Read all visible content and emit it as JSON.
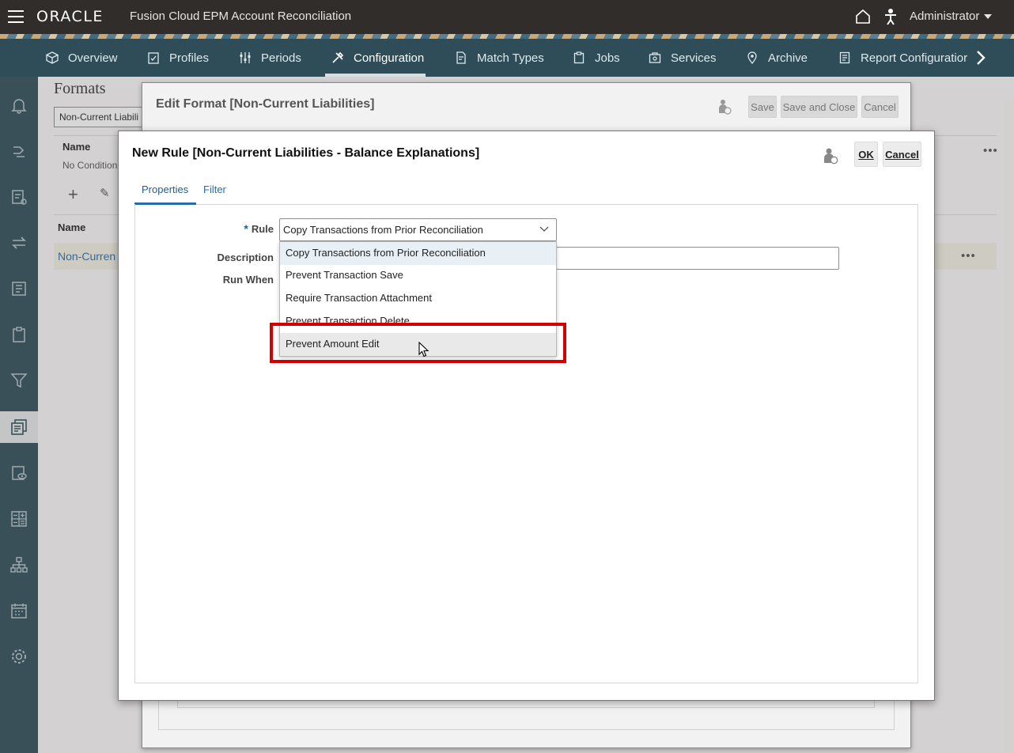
{
  "header": {
    "logo": "ORACLE",
    "app_title": "Fusion Cloud EPM Account Reconciliation",
    "user": "Administrator"
  },
  "nav": {
    "items": [
      {
        "label": "Overview",
        "icon": "overview-icon"
      },
      {
        "label": "Profiles",
        "icon": "profiles-icon"
      },
      {
        "label": "Periods",
        "icon": "periods-icon"
      },
      {
        "label": "Configuration",
        "icon": "configuration-icon",
        "active": true
      },
      {
        "label": "Match Types",
        "icon": "match-types-icon"
      },
      {
        "label": "Jobs",
        "icon": "jobs-icon"
      },
      {
        "label": "Services",
        "icon": "services-icon"
      },
      {
        "label": "Archive",
        "icon": "archive-icon"
      },
      {
        "label": "Report Configuratior",
        "icon": "report-configuration-icon"
      }
    ]
  },
  "background": {
    "title": "Formats",
    "filter_value": "Non-Current Liabili",
    "name_header": "Name",
    "no_conditions": "No Condition",
    "name_header_2": "Name",
    "row_link": "Non-Curren"
  },
  "edit_dialog": {
    "title": "Edit Format [Non-Current Liabilities]",
    "save": "Save",
    "save_close": "Save and Close",
    "cancel": "Cancel"
  },
  "rule_dialog": {
    "title": "New Rule [Non-Current Liabilities - Balance Explanations]",
    "ok": "OK",
    "cancel": "Cancel",
    "tabs": [
      "Properties",
      "Filter"
    ],
    "rule_label": "Rule",
    "rule_required_marker": "*",
    "description_label": "Description",
    "run_when_label": "Run When",
    "rule_value": "Copy Transactions from Prior Reconciliation",
    "options": [
      "Copy Transactions from Prior Reconciliation",
      "Prevent Transaction Save",
      "Require Transaction Attachment",
      "Prevent Transaction Delete",
      "Prevent Amount Edit"
    ]
  },
  "colors": {
    "header_bg": "#312d2a",
    "nav_bg": "#2e4d58",
    "link": "#2b6ca8",
    "highlight_box": "#d40000"
  }
}
